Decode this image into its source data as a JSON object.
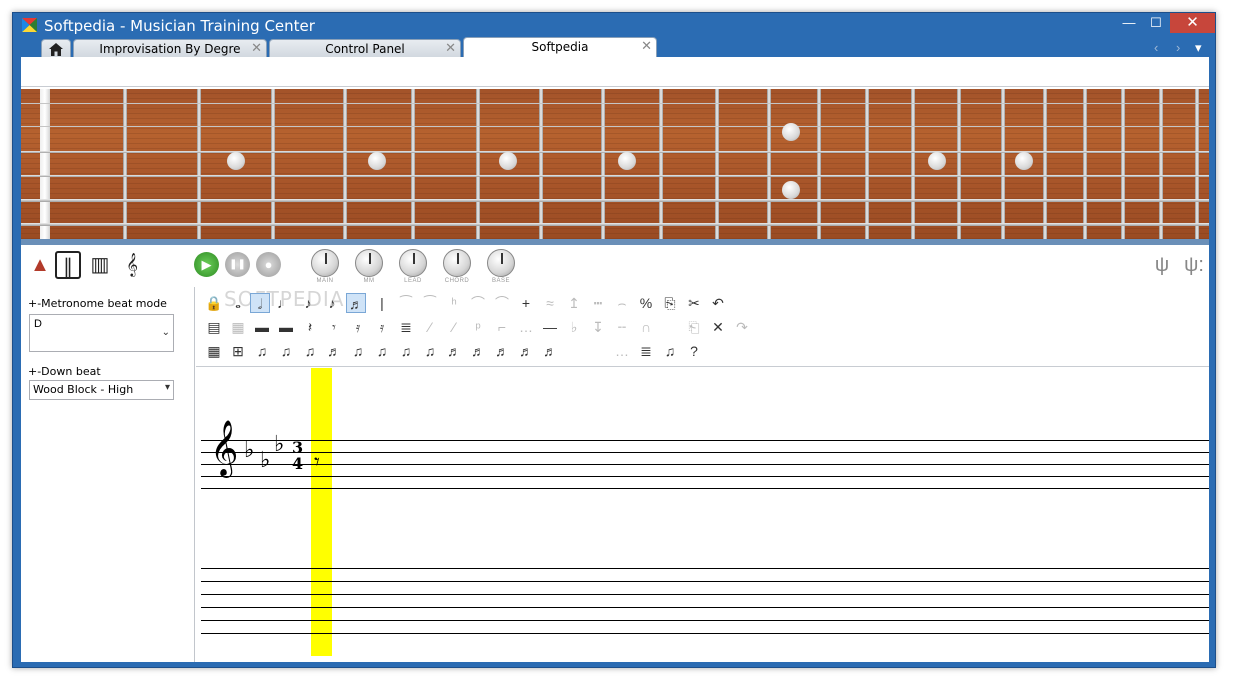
{
  "window": {
    "title": "Softpedia - Musician Training Center",
    "minimize_glyph": "—",
    "maximize_glyph": "☐",
    "close_glyph": "✕"
  },
  "tabs": [
    {
      "label": "Improvisation By Degre",
      "active": false
    },
    {
      "label": "Control Panel",
      "active": false
    },
    {
      "label": "Softpedia",
      "active": true
    }
  ],
  "tab_close_glyph": "✕",
  "tab_nav": {
    "back": "‹",
    "forward": "›",
    "menu": "▾"
  },
  "toolbar": {
    "tools": [
      {
        "name": "metronome-icon",
        "glyph": "▲"
      },
      {
        "name": "drumsticks-icon",
        "glyph": "∥"
      },
      {
        "name": "piano-icon",
        "glyph": "▥"
      },
      {
        "name": "treble-clef-icon",
        "glyph": "𝄞"
      }
    ],
    "transport": {
      "play": "▶",
      "pause": "❚❚",
      "stop": "●"
    },
    "knobs": [
      "MAIN",
      "MM",
      "LEAD",
      "CHORD",
      "BASE"
    ],
    "tuner_glyphs": [
      "ψ",
      "ψ:"
    ]
  },
  "left_panel": {
    "metronome_label": "+-Metronome beat mode",
    "metronome_value": "D",
    "downbeat_label": "+-Down beat",
    "downbeat_value": "Wood Block - High"
  },
  "watermark": "SOFTPEDIA",
  "score": {
    "clef": "𝄞",
    "flats": [
      "♭",
      "♭",
      "♭"
    ],
    "time_signature": {
      "top": "3",
      "bottom": "4"
    }
  }
}
